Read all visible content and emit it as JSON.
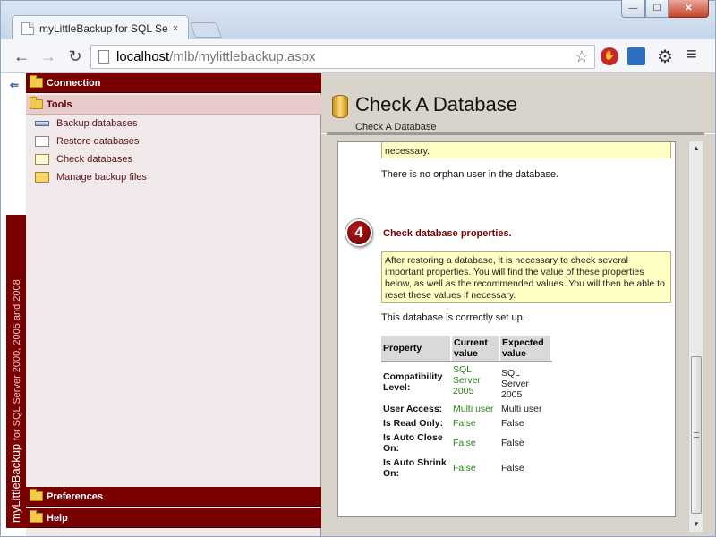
{
  "browser": {
    "tab_title": "myLittleBackup for SQL Se",
    "tab_close": "×",
    "window": {
      "minimize": "—",
      "maximize": "☐",
      "close": "✕"
    },
    "url_host": "localhost",
    "url_path": "/mlb/mylittlebackup.aspx",
    "icons": {
      "back": "←",
      "forward": "→",
      "reload": "↻",
      "star": "☆",
      "gear": "⚙",
      "menu": "≡",
      "stop": "✋"
    }
  },
  "brand": {
    "name": "myLittleBackup",
    "subtitle": "for SQL Server 2000, 2005 and 2008"
  },
  "sidebar": {
    "sections": [
      {
        "label": "Connection"
      },
      {
        "label": "Tools"
      },
      {
        "label": "Preferences"
      },
      {
        "label": "Help"
      }
    ],
    "tools_items": [
      {
        "label": "Backup databases",
        "icon": "backup-icon"
      },
      {
        "label": "Restore databases",
        "icon": "restore-icon"
      },
      {
        "label": "Check databases",
        "icon": "check-icon"
      },
      {
        "label": "Manage backup files",
        "icon": "files-icon"
      }
    ]
  },
  "main": {
    "title": "Check A Database",
    "breadcrumb": "Check A Database",
    "top_note": "necessary.",
    "orphan_text": "There is no orphan user in the database.",
    "step_number": "4",
    "step_title": "Check database properties.",
    "step_note": "After restoring a database, it is necessary to check several important properties. You will find the value of these properties below, as well as the recommended values. You will then be able to reset these values if necessary.",
    "status_text": "This database is correctly set up.",
    "table": {
      "headers": [
        "Property",
        "Current value",
        "Expected value"
      ],
      "rows": [
        [
          "Compatibility Level:",
          "SQL Server 2005",
          "SQL Server 2005"
        ],
        [
          "User Access:",
          "Multi user",
          "Multi user"
        ],
        [
          "Is Read Only:",
          "False",
          "False"
        ],
        [
          "Is Auto Close On:",
          "False",
          "False"
        ],
        [
          "Is Auto Shrink On:",
          "False",
          "False"
        ]
      ]
    }
  },
  "colors": {
    "brand": "#7a0000",
    "ok_value": "#2e7d1e",
    "note_bg": "#ffffc4"
  }
}
